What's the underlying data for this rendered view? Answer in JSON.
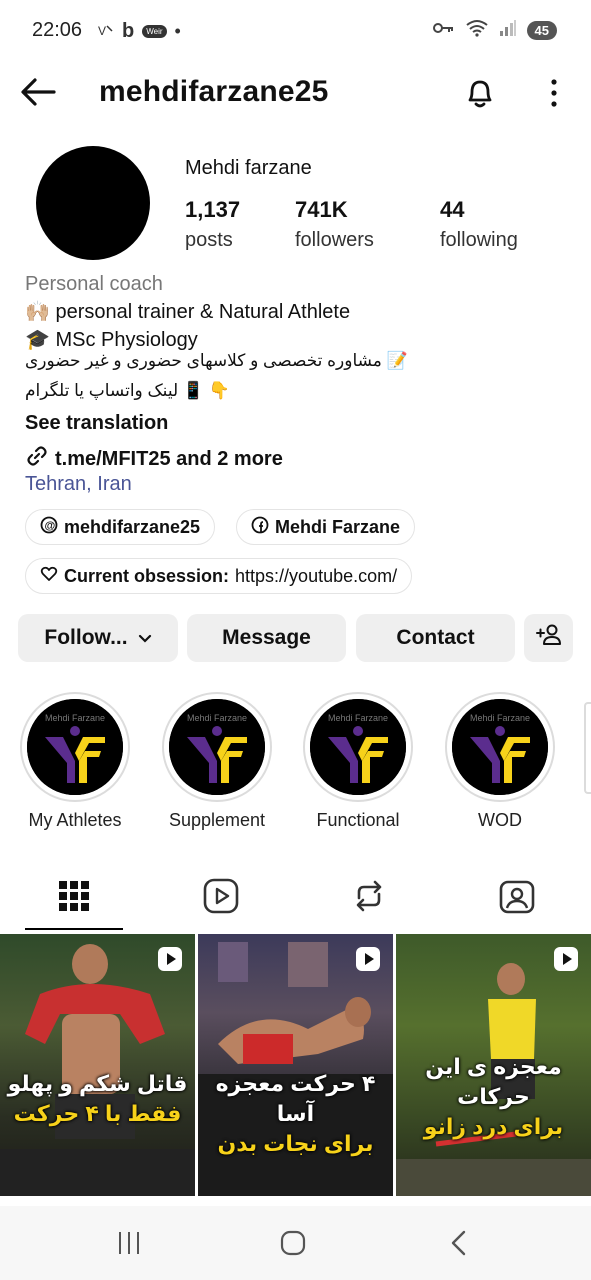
{
  "status_bar": {
    "time": "22:06",
    "left_icons": [
      "vowifi-icon",
      "b-app-icon",
      "weir-icon",
      "dot-icon"
    ],
    "weir_label": "Weir",
    "battery": "45"
  },
  "header": {
    "username": "mehdifarzane25"
  },
  "profile": {
    "full_name": "Mehdi farzane",
    "stats": [
      {
        "value": "1,137",
        "label": "posts"
      },
      {
        "value": "741K",
        "label": "followers"
      },
      {
        "value": "44",
        "label": "following"
      }
    ],
    "category": "Personal coach",
    "bio": [
      "🙌🏼 personal trainer & Natural Athlete",
      "🎓  MSc Physiology",
      "مشاوره تخصصی و کلاسهای حضوری و غیر حضوری 📝",
      "لینک واتساپ یا تلگرام 📱 👇"
    ],
    "see_translation": "See translation",
    "link": "t.me/MFIT25 and 2 more",
    "location": "Tehran, Iran",
    "chips": {
      "threads": "mehdifarzane25",
      "facebook": "Mehdi Farzane",
      "obsession_label": "Current obsession:",
      "obsession_value": "https://youtube.com/"
    }
  },
  "actions": {
    "follow": "Follow...",
    "message": "Message",
    "contact": "Contact"
  },
  "highlights": [
    {
      "label": "My Athletes"
    },
    {
      "label": "Supplement"
    },
    {
      "label": "Functional"
    },
    {
      "label": "WOD"
    }
  ],
  "highlight_logo_text": "Mehdi Farzane",
  "tabs": [
    "grid-tab",
    "reels-tab",
    "reposts-tab",
    "tagged-tab"
  ],
  "posts": [
    {
      "line1": "قاتل شکم و پهلو",
      "line2": "فقط با ۴ حرکت"
    },
    {
      "line1": "۴ حرکت معجزه آسا",
      "line2": "برای نجات بدن"
    },
    {
      "line1": "معجزه ی این حرکات",
      "line2": "برای درد زانو"
    }
  ],
  "colors": {
    "accent_yellow": "#f7d21a",
    "logo_purple": "#5b2d8e",
    "location_blue": "#4a5596",
    "button_gray": "#efefef"
  }
}
